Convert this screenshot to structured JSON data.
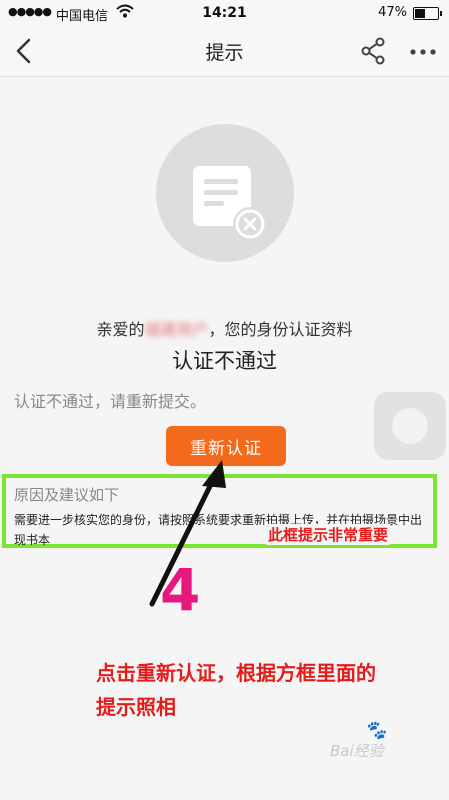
{
  "status_bar": {
    "signal": "●●●●●",
    "carrier": "中国电信",
    "time": "14:21",
    "battery_pct": "47%",
    "battery_level": 0.47
  },
  "nav": {
    "title": "提示"
  },
  "content": {
    "greeting_prefix": "亲爱的",
    "greeting_masked": "福建用户",
    "greeting_suffix": "，您的身份认证资料",
    "status_title": "认证不通过",
    "hint": "认证不通过，请重新提交。",
    "reauth_button": "重新认证"
  },
  "reason": {
    "title": "原因及建议如下",
    "body": "需要进一步核实您的身份，请按照系统要求重新拍摄上传，并在拍摄场景中出现书本"
  },
  "annotations": {
    "box_callout": "此框提示非常重要",
    "step_number": "4",
    "instruction": "点击重新认证，根据方框里面的提示照相",
    "box_color": "#7be334",
    "callout_color": "#e51c1c",
    "step_color": "#e8177f"
  },
  "watermark": {
    "text": "Bai经验",
    "paw": "🐾"
  },
  "colors": {
    "accent": "#f46a1c"
  }
}
